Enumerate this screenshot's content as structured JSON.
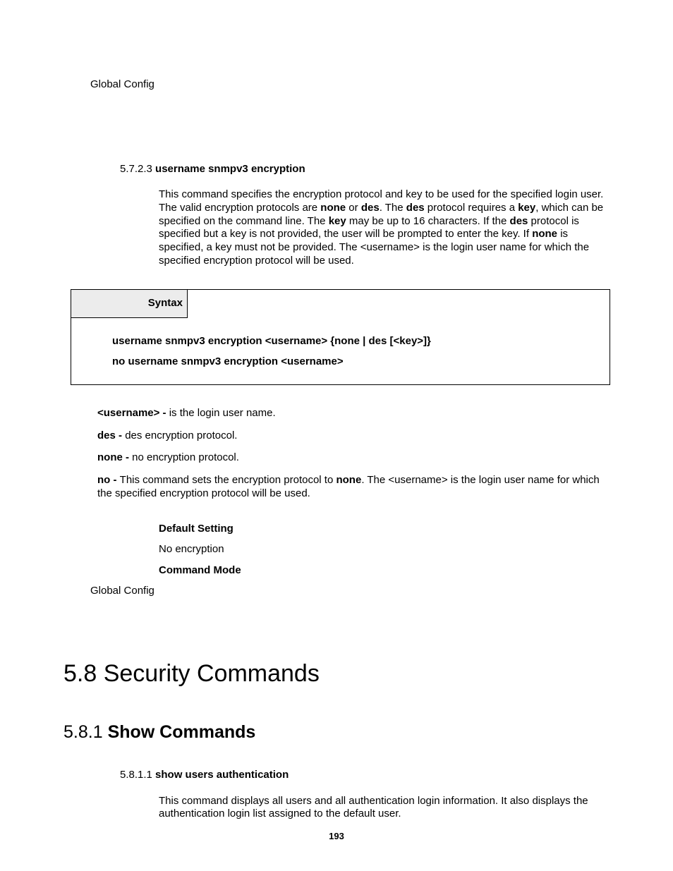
{
  "top_context": "Global Config",
  "section_5723": {
    "num": "5.7.2.3",
    "title": "username snmpv3 encryption",
    "para_1a": "This command specifies the encryption protocol and key to be used for the specified login user. The valid encryption protocols are ",
    "bold_none": "none",
    "para_1b": " or ",
    "bold_des": "des",
    "para_1c": ". The ",
    "para_1d": " protocol requires a ",
    "bold_key": "key",
    "para_1e": ", which can be specified on the command line. The ",
    "para_1f": " may be up to 16 characters. If the ",
    "para_1g": " protocol is specified but a key is not provided, the user will be prompted to enter the key. If ",
    "para_1h": " is specified, a key must not be provided. The <username> is the login user name for which the specified encryption protocol will be used."
  },
  "syntax": {
    "label": "Syntax",
    "line1": "username snmpv3 encryption <username> {none | des [<key>]}",
    "line2": "no username snmpv3 encryption <username>"
  },
  "params": {
    "username_label": "<username> - ",
    "username_text": "is the login user name.",
    "des_label": "des - ",
    "des_text": "des encryption protocol.",
    "none_label": "none - ",
    "none_text": "no encryption protocol.",
    "no_label": "no - ",
    "no_text_a": "This command sets the encryption protocol to ",
    "no_bold": "none",
    "no_text_b": ". The <username> is the login user name for which the specified encryption protocol will be used."
  },
  "default_setting_label": "Default Setting",
  "default_setting_value": "No encryption",
  "command_mode_label": "Command Mode",
  "command_mode_value": "Global Config",
  "h1": {
    "num": "5.8",
    "title": "Security Commands"
  },
  "h2": {
    "num": "5.8.1",
    "title": "Show Commands"
  },
  "section_5811": {
    "num": "5.8.1.1",
    "title": "show users authentication",
    "para": "This command displays all users and all authentication login information. It also displays the authentication login list assigned to the default user."
  },
  "page_number": "193"
}
